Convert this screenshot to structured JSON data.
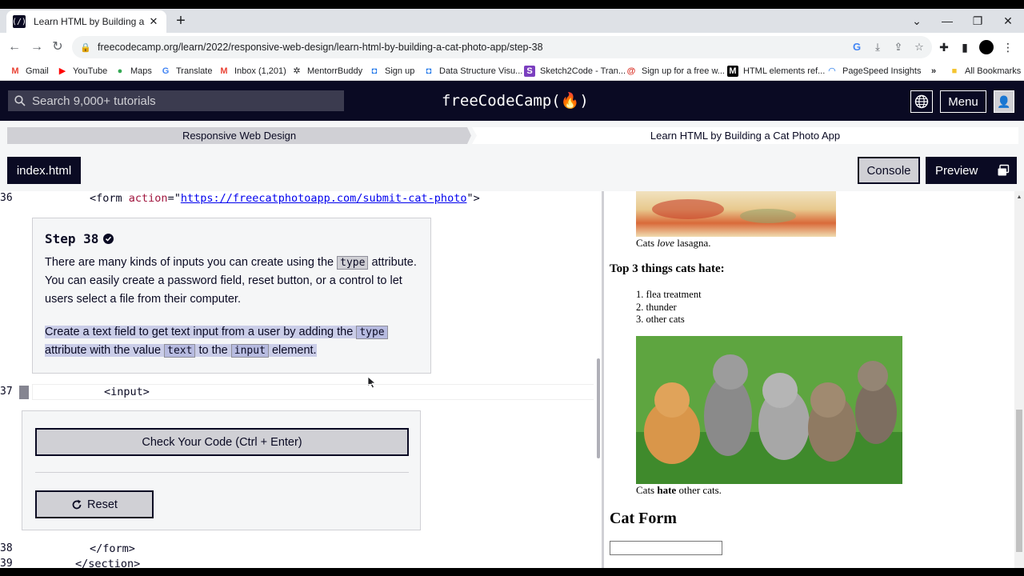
{
  "browser": {
    "tab_title": "Learn HTML by Building a Cat Ph",
    "tab_favicon": "fcc",
    "url": "freecodecamp.org/learn/2022/responsive-web-design/learn-html-by-building-a-cat-photo-app/step-38",
    "bookmarks": [
      {
        "label": "Gmail",
        "icon": "M",
        "color": "#ea4335"
      },
      {
        "label": "YouTube",
        "icon": "▶",
        "color": "#ff0000"
      },
      {
        "label": "Maps",
        "icon": "📍",
        "color": "#34a853"
      },
      {
        "label": "Translate",
        "icon": "G",
        "color": "#4285f4"
      },
      {
        "label": "Inbox (1,201)",
        "icon": "M",
        "color": "#ea4335"
      },
      {
        "label": "MentorrBuddy",
        "icon": "✲",
        "color": "#202124"
      },
      {
        "label": "Sign up",
        "icon": "◘",
        "color": "#1a73e8"
      },
      {
        "label": "Data Structure Visu...",
        "icon": "◘",
        "color": "#1a73e8"
      },
      {
        "label": "Sketch2Code - Tran...",
        "icon": "S",
        "color": "#7b3fbf"
      },
      {
        "label": "Sign up for a free w...",
        "icon": "@",
        "color": "#d93025"
      },
      {
        "label": "HTML elements ref...",
        "icon": "M",
        "color": "#000000"
      },
      {
        "label": "PageSpeed Insights",
        "icon": "◠",
        "color": "#1a73e8"
      }
    ],
    "all_bookmarks": "All Bookmarks"
  },
  "nav": {
    "search_placeholder": "Search 9,000+ tutorials",
    "logo": "freeCodeCamp(🔥)",
    "menu": "Menu"
  },
  "breadcrumb": {
    "left": "Responsive Web Design",
    "right": "Learn HTML by Building a Cat Photo App"
  },
  "toolbar": {
    "file_tab": "index.html",
    "console": "Console",
    "preview": "Preview"
  },
  "editor": {
    "line36_num": "36",
    "line36_code": {
      "open": "<form ",
      "attr": "action",
      "eq": "=\"",
      "url": "https://freecatphotoapp.com/submit-cat-photo",
      "close": "\">"
    },
    "step_title": "Step 38",
    "p1": {
      "a": "There are many kinds of inputs you can create using the ",
      "code": "type",
      "b": " attribute. You can easily create a password field, reset button, or a control to let users select a file from their computer."
    },
    "p2": {
      "a": "Create a text field to get text input from a user by adding the ",
      "code1": "type",
      "b": " attribute with the value ",
      "code2": "text",
      "c": " to the ",
      "code3": "input",
      "d": " element."
    },
    "line37_num": "37",
    "line37_code": "<input>",
    "check_button": "Check Your Code (Ctrl + Enter)",
    "reset_button": "Reset",
    "line38_num": "38",
    "line38_code": "</form>",
    "line39_num": "39",
    "line39_code": "</section>"
  },
  "preview": {
    "caption1_pre": "Cats ",
    "caption1_em": "love",
    "caption1_post": " lasagna.",
    "hate_heading": "Top 3 things cats hate:",
    "hate_items": [
      "flea treatment",
      "thunder",
      "other cats"
    ],
    "caption2_pre": "Cats ",
    "caption2_strong": "hate",
    "caption2_post": " other cats.",
    "form_heading": "Cat Form"
  }
}
